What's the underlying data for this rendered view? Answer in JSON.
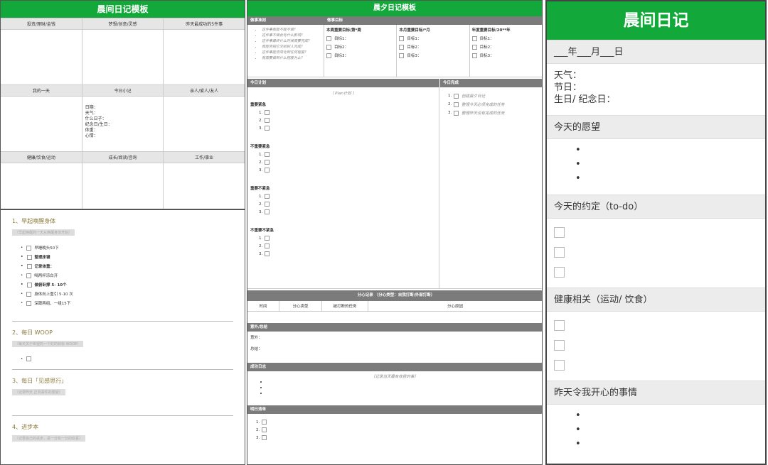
{
  "panel1": {
    "title": "晨间日记模板",
    "row1": [
      "投资/理财/金钱",
      "梦想/创意/灵感",
      "昨天最成功的5件事"
    ],
    "row2": [
      "我的一天",
      "今日小记",
      "亲人/爱人/友人"
    ],
    "row3": [
      "健康/饮食/运动",
      "成长/阅读/咨询",
      "工作/事业"
    ],
    "daily_fields": [
      "日期：",
      "天气：",
      "什么日子：",
      "纪念日/生日：",
      "体重：",
      "心情："
    ]
  },
  "panel2": {
    "sections": [
      {
        "title": "1、早起唤醒身体",
        "hint": "（早起唤醒的一天从唤醒身体开始）",
        "items": [
          "早睡晚头50下",
          "整理床铺",
          "记录体重：",
          "喝两杯凉白开",
          "做俯卧撑 5- 10个",
          "身体向上重引 5-10 次",
          "深蹲两组，一组15下"
        ],
        "bold": [
          false,
          true,
          true,
          false,
          true,
          false,
          false
        ]
      },
      {
        "title": "2、每日 WOOP",
        "hint": "（每天关于希望的一个好的目标 WOOP）",
        "items": [
          ""
        ],
        "bold": [
          false
        ]
      },
      {
        "title": "3、每日「见感思行」",
        "hint": "（记录昨天 正向事件的感受）",
        "items": [],
        "bold": []
      },
      {
        "title": "4、进步本",
        "hint": "（记录自己的进步，进一分有一分的欢喜）",
        "items": [],
        "bold": []
      }
    ]
  },
  "panel3": {
    "title": "晨夕日记模板",
    "principles_label": "做事准则",
    "goals_label": "做事目标",
    "principles": [
      "这件事我能不能不做?",
      "这件事不做会有什么影响?",
      "这件事最终什么时候需要完成?",
      "我能否把它交给别人完成?",
      "这件事能否简化到任何程度?",
      "我需要做到什么程度为止?"
    ],
    "goal_cols": [
      {
        "title": "本周重要目标/第*周",
        "items": [
          "目标1：",
          "目标2：",
          "目标3："
        ]
      },
      {
        "title": "本月重要目标/*月",
        "items": [
          "目标1：",
          "目标2：",
          "目标3："
        ]
      },
      {
        "title": "年度重要目标/20**年",
        "items": [
          "目标1：",
          "目标2：",
          "目标3："
        ]
      }
    ],
    "plan_label": "今日计划",
    "done_label": "今日完成",
    "plan_hint": "（ Plan计划 ）",
    "quadrants": [
      "重要紧急",
      "不重要紧急",
      "重要不紧急",
      "不重要不紧急"
    ],
    "nums": [
      "1.",
      "2.",
      "3."
    ],
    "done_items": [
      "1.",
      "2.",
      "3."
    ],
    "done_texts": [
      "创建晨夕日记",
      "整理今天必须完成的任务",
      "整理昨天没有完成的任务"
    ],
    "distraction_label": "分心记录 （分心类型：自我打断/外部打断）",
    "dist_cols": [
      "时间",
      "分心类型",
      "被打断的任务",
      "分心原因"
    ],
    "summary_label": "意外/总结",
    "summary_fields": [
      "意外：",
      "总结："
    ],
    "success_label": "成功日志",
    "success_hint": "（记录当天最有收获的事）",
    "tomorrow_label": "明日清单"
  },
  "panel4": {
    "title": "晨间日记",
    "date_line": "___年___月___日",
    "fields": [
      "天气：",
      "节日：",
      "生日/ 纪念日："
    ],
    "sections": [
      "今天的愿望",
      "今天的约定（to-do）",
      "健康相关（运动/ 饮食）",
      "昨天令我开心的事情"
    ]
  },
  "colors": {
    "accent": "#12a83a",
    "band": "#7b7b7b"
  }
}
